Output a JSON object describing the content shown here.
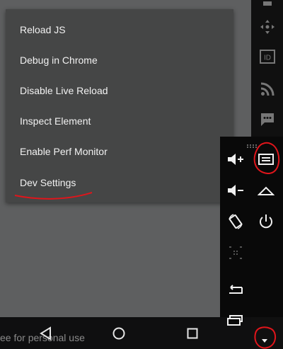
{
  "dev_menu": {
    "items": [
      {
        "label": "Reload JS"
      },
      {
        "label": "Debug in Chrome"
      },
      {
        "label": "Disable Live Reload"
      },
      {
        "label": "Inspect Element"
      },
      {
        "label": "Enable Perf Monitor"
      },
      {
        "label": "Dev Settings"
      }
    ]
  },
  "right_strip": {
    "icons": [
      "move-icon",
      "id-icon",
      "rss-icon",
      "chat-icon"
    ],
    "id_label": "ID"
  },
  "watermark": {
    "text": "ee for personal use"
  },
  "nav_bar": {
    "buttons": [
      "back-icon",
      "home-icon",
      "recents-icon"
    ]
  },
  "side_panel": {
    "controls": [
      "volume-up-icon",
      "menu-icon",
      "volume-down-icon",
      "home-button-icon",
      "rotate-icon",
      "power-icon",
      "screenshot-icon",
      "return-icon",
      "recent-apps-icon",
      "collapse-icon"
    ]
  },
  "colors": {
    "screen_bg": "#5e5f60",
    "menu_bg": "#454646",
    "menu_text": "#f2f2f2",
    "annotation": "#e0151b"
  }
}
